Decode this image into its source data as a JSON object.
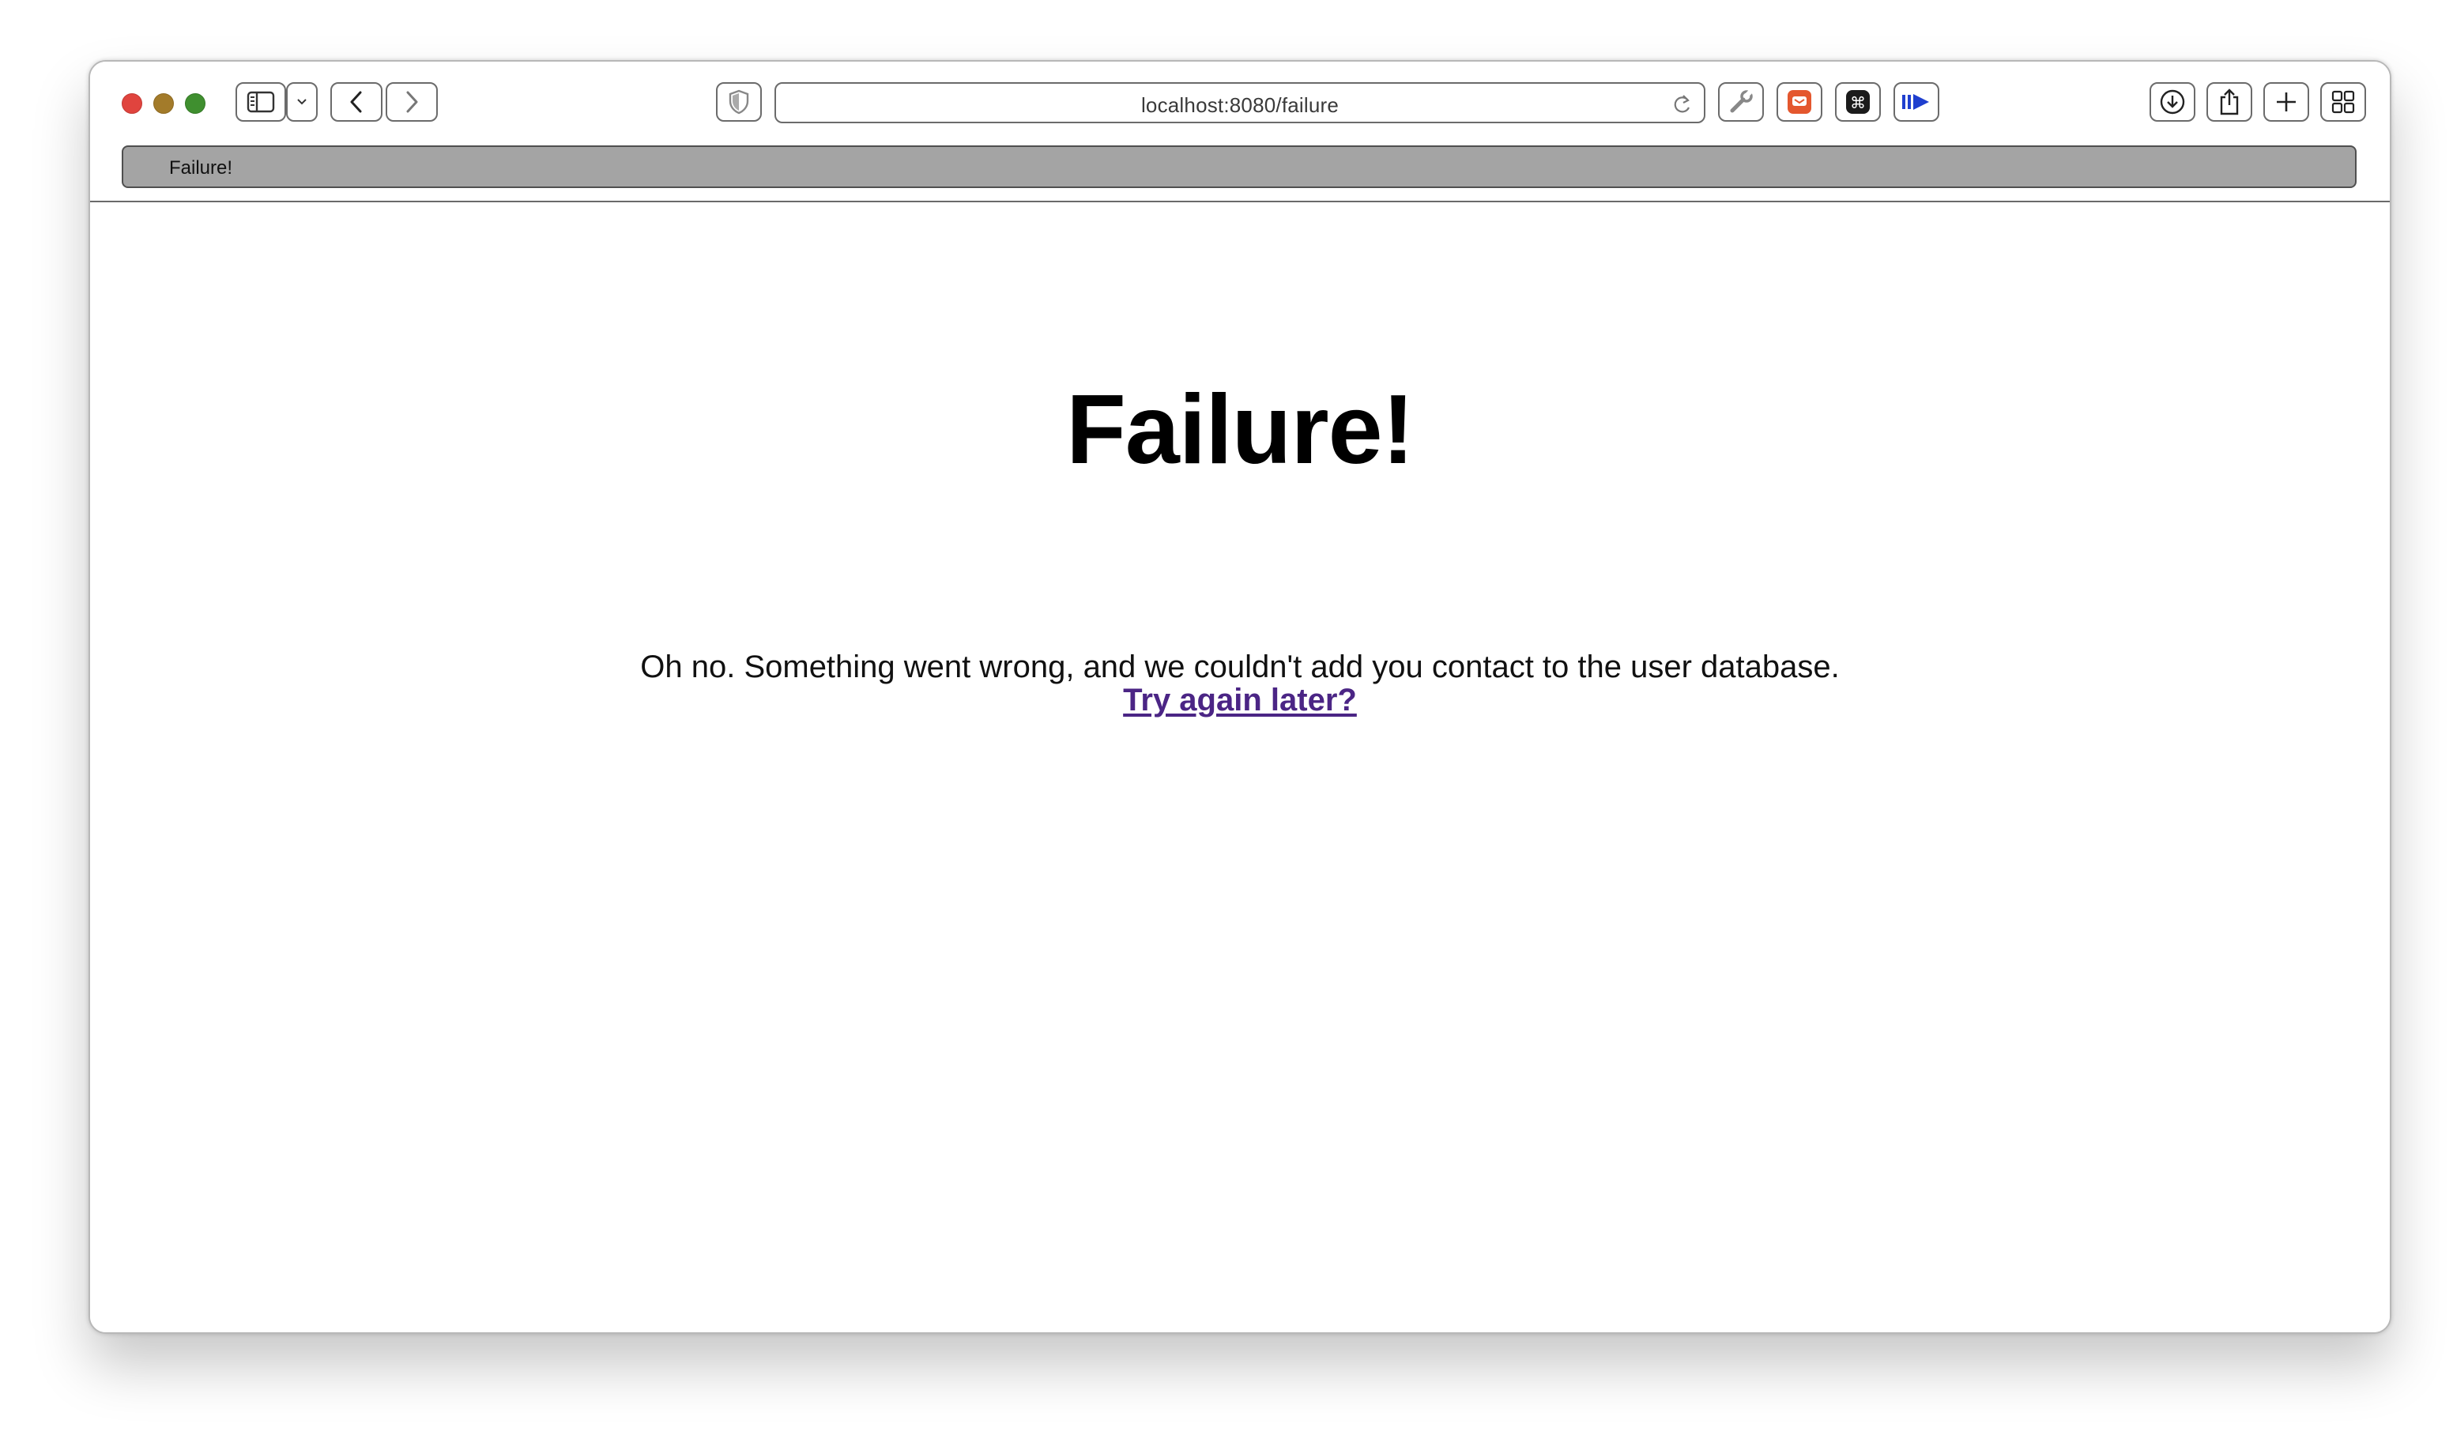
{
  "browser": {
    "url": "localhost:8080/failure",
    "tab_title": "Failure!",
    "colors": {
      "close": "#e0443e",
      "minimize": "#a37b2a",
      "maximize": "#3f8f2f",
      "extension_orange": "#e4572e",
      "extension_blue": "#1f3fcf"
    },
    "toolbar_icons": [
      "sidebar-icon",
      "chevron-down-icon",
      "back-arrow-icon",
      "forward-arrow-icon",
      "privacy-shield-icon",
      "reload-icon",
      "wrench-icon",
      "extension-orange-icon",
      "command-key-icon",
      "play-forward-icon",
      "download-icon",
      "share-icon",
      "new-tab-icon",
      "tab-overview-icon"
    ]
  },
  "page": {
    "title": "Failure!",
    "message": "Oh no. Something went wrong, and we couldn't add you contact to the user database.",
    "link_text": "Try again later?",
    "link_color": "#4b2585"
  }
}
